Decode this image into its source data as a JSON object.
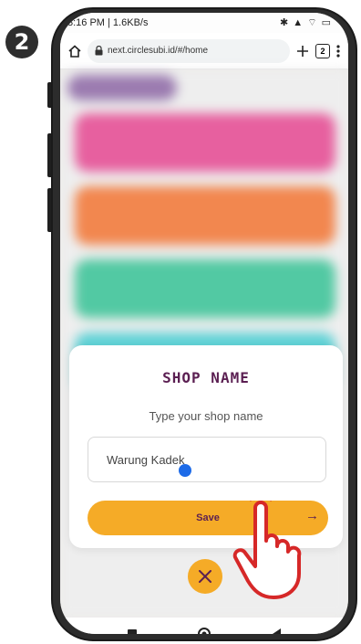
{
  "step": {
    "number": "2"
  },
  "status_bar": {
    "time_speed": "3:16 PM | 1.6KB/s",
    "right_icons": "✱ ▲ ⌔ ▭"
  },
  "browser": {
    "url": "next.circlesubi.id/#/home",
    "tab_count": "2"
  },
  "background_cards": {
    "colors": [
      "#e7609f",
      "#f2874f",
      "#52c9a3",
      "#5fd2d6"
    ]
  },
  "modal": {
    "title": "SHOP NAME",
    "subtitle": "Type your shop name",
    "input_value": "Warung Kadek",
    "save_label": "Save",
    "save_arrow": "→"
  },
  "colors": {
    "accent": "#f5ab27",
    "title": "#5b1f52",
    "caret": "#1d6be8",
    "hand": "#d62828"
  },
  "icons": [
    "home-icon",
    "lock-icon",
    "plus-icon",
    "tab-count-icon",
    "more-icon",
    "close-icon",
    "stop-icon",
    "circle-home-icon",
    "back-icon",
    "hand-pointer-icon"
  ]
}
